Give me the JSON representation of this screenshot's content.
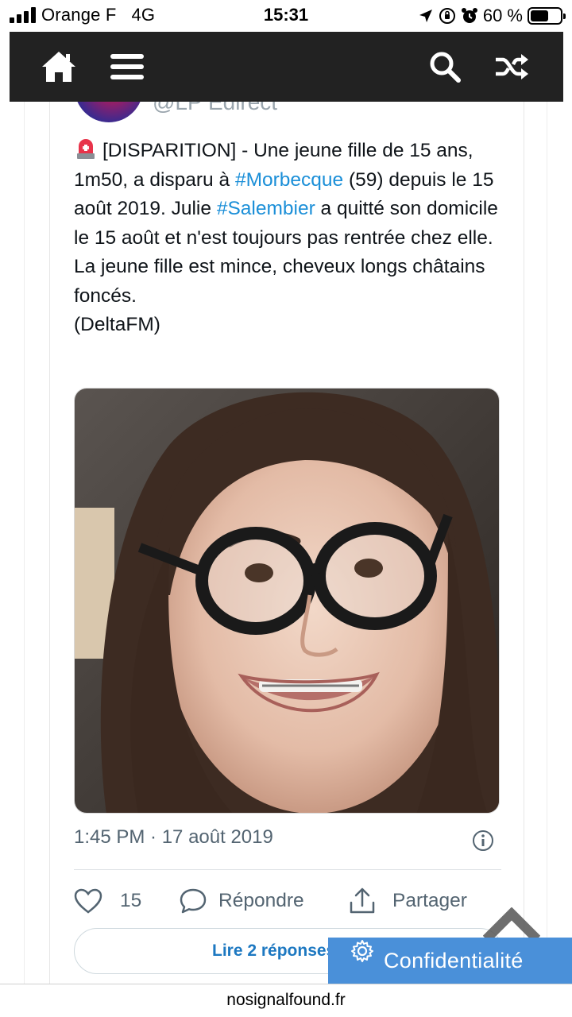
{
  "status_bar": {
    "carrier": "Orange F",
    "network": "4G",
    "time": "15:31",
    "battery_percent": "60 %",
    "battery_level": 0.6
  },
  "nav": {
    "icons": [
      "home-icon",
      "menu-icon",
      "search-icon",
      "shuffle-icon"
    ]
  },
  "tweet": {
    "handle_partial": "@LP Edirect",
    "text_parts": [
      {
        "t": "[DISPARITION] - Une jeune fille de 15 ans, 1m50, a disparu à "
      },
      {
        "h": "#Morbecque"
      },
      {
        "t": " (59) depuis le 15 août 2019. Julie "
      },
      {
        "h": "#Salembier"
      },
      {
        "t": " a quitté son domicile le 15 août et n'est toujours pas rentrée chez elle.\nLa jeune fille est mince, cheveux longs châtains foncés.\n(DeltaFM)"
      }
    ],
    "timestamp": "1:45 PM · 17 août 2019",
    "likes": "15",
    "reply_label": "Répondre",
    "share_label": "Partager",
    "read_replies_label": "Lire 2 réponses"
  },
  "privacy_button": {
    "label": "Confidentialité"
  },
  "footer": {
    "site": "nosignalfound.fr"
  },
  "colors": {
    "nav_bg": "#222222",
    "hashtag": "#1b8fd8",
    "privacy_bg": "#4a90d9",
    "meta_text": "#536471"
  }
}
